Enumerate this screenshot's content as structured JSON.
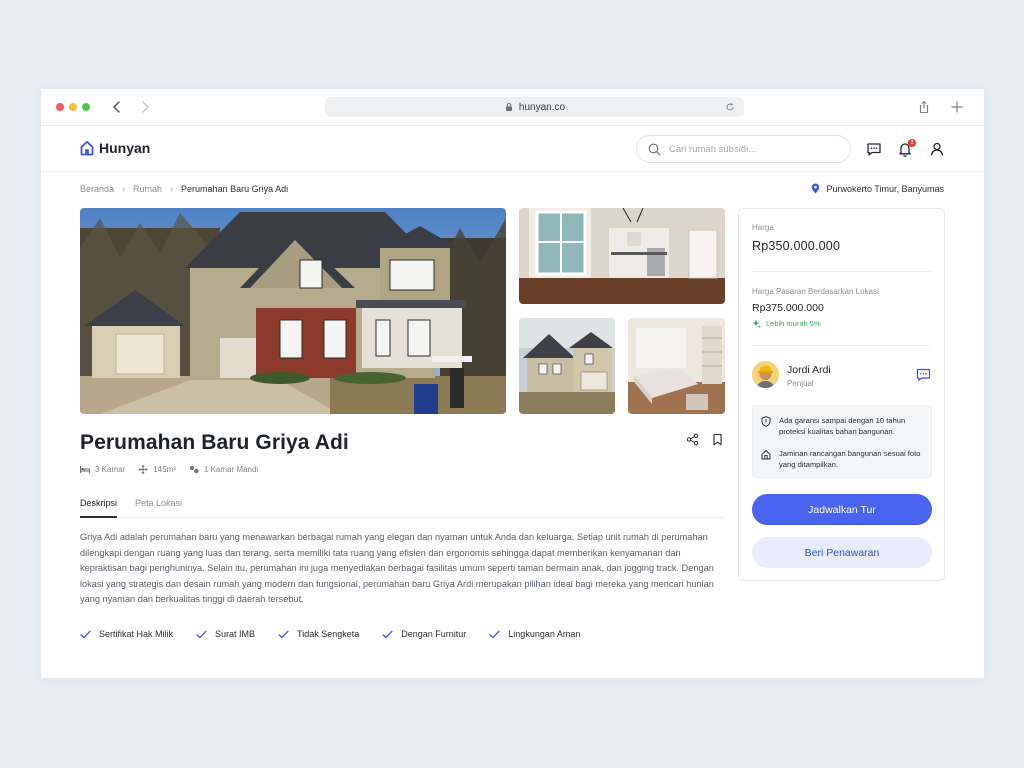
{
  "browser": {
    "url": "hunyan.co"
  },
  "header": {
    "brand": "Hunyan",
    "search_placeholder": "Cari rumah subsidi...",
    "notification_count": "2"
  },
  "breadcrumb": {
    "items": [
      "Beranda",
      "Rumah",
      "Perumahan Baru Griya Adi"
    ]
  },
  "location": "Purwokerto Timur, Banyumas",
  "listing": {
    "title": "Perumahan Baru Griya Adi",
    "specs": [
      "3 Kamar",
      "145m²",
      "1 Kamar Mandi"
    ],
    "tabs": [
      "Deskripsi",
      "Peta Lokasi"
    ],
    "description": "Griya Adi adalah perumahan baru yang menawarkan berbagai rumah yang elegan dan nyaman untuk Anda dan keluarga. Setiap unit rumah di perumahan dilengkapi dengan ruang yang luas dan terang, serta memiliki tata ruang yang efisien dan ergonomis sehingga dapat memberikan kenyamanan dan kepraktisan bagi penghuninya. Selain itu, perumahan ini juga menyediakan berbagai fasilitas umum seperti taman bermain anak, dan jogging track. Dengan lokasi yang strategis dan desain rumah yang modern dan fungsional, perumahan baru Griya Ardi merupakan pilihan ideal bagi mereka yang mencari hunian yang nyaman dan berkualitas tinggi di daerah tersebut.",
    "features": [
      "Sertifikat Hak Milik",
      "Surat IMB",
      "Tidak Sengketa",
      "Dengan Furnitur",
      "Lingkungan Aman"
    ]
  },
  "pricing": {
    "price_label": "Harga",
    "price": "Rp350.000.000",
    "market_label": "Harga Pasaran Berdasarkan Lokasi",
    "market_price": "Rp375.000.000",
    "cheaper_note": "Lebih murah 5%"
  },
  "seller": {
    "name": "Jordi Ardi",
    "role": "Penjual"
  },
  "guarantees": [
    "Ada garansi sampai dengan 10 tahun proteksi kualitas bahan bangunan.",
    "Jaminan rancangan bangunan sesuai foto yang ditampilkan."
  ],
  "actions": {
    "primary": "Jadwalkan Tur",
    "secondary": "Beri Penawaran"
  },
  "colors": {
    "accent": "#4a64f2",
    "accent_light": "#e9ecfd",
    "success": "#2eae4e",
    "badge": "#e53935"
  }
}
